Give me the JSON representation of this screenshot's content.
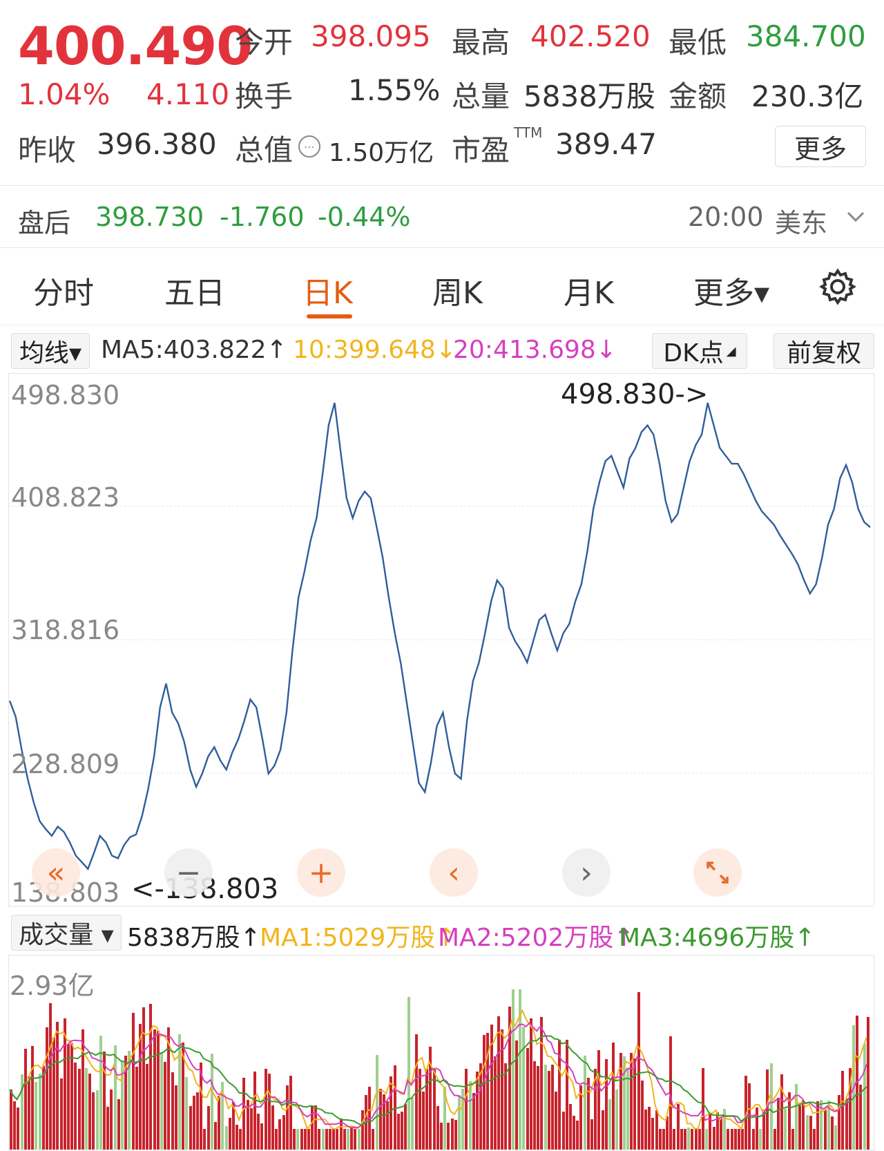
{
  "quote": {
    "price": "400.490",
    "change_pct": "1.04%",
    "change": "4.110",
    "prev_close_label": "昨收",
    "prev_close": "396.380",
    "open_label": "今开",
    "open": "398.095",
    "high_label": "最高",
    "high": "402.520",
    "low_label": "最低",
    "low": "384.700",
    "turnover_label": "换手",
    "turnover": "1.55%",
    "volume_label": "总量",
    "volume": "5838万股",
    "amount_label": "金额",
    "amount": "230.3亿",
    "mktcap_label": "总值",
    "mktcap": "1.50万亿",
    "pe_label": "市盈",
    "pe_sup": "TTM",
    "pe": "389.47",
    "more_label": "更多"
  },
  "after_hours": {
    "label": "盘后",
    "price": "398.730",
    "change": "-1.760",
    "change_pct": "-0.44%",
    "time": "20:00",
    "tz": "美东"
  },
  "tabs": [
    {
      "label": "分时"
    },
    {
      "label": "五日"
    },
    {
      "label": "日K"
    },
    {
      "label": "周K"
    },
    {
      "label": "月K"
    },
    {
      "label": "更多▾"
    }
  ],
  "indicators": {
    "select_label": "均线▾",
    "ma5": "MA5:403.822↑",
    "ma10": "10:399.648↓",
    "ma20": "20:413.698↓",
    "dk_label": "DK点",
    "adjust_label": "前复权"
  },
  "price_axis": [
    "498.830",
    "408.823",
    "318.816",
    "228.809",
    "138.803"
  ],
  "annotations": {
    "max": "498.830->",
    "min": "<-138.803"
  },
  "volume_header": {
    "select_label": "成交量 ▾",
    "vol": "5838万股↑",
    "ma1": "MA1:5029万股↑",
    "ma2": "MA2:5202万股↑",
    "ma3": "MA3:4696万股↑"
  },
  "volume_axis": "2.93亿",
  "colors": {
    "up": "#e2333c",
    "down": "#2e9e3e",
    "accent": "#e65b12",
    "line": "#2f5d9a",
    "ma1": "#f2b41c",
    "ma2": "#d63fbf",
    "ma3": "#3a9a2e"
  },
  "chart_data": {
    "type": "line",
    "ylim": [
      138.803,
      498.83
    ],
    "max_label": "498.830",
    "min_label": "138.803",
    "y": [
      267,
      255,
      230,
      208,
      190,
      176,
      170,
      165,
      172,
      168,
      160,
      150,
      145,
      140,
      152,
      165,
      160,
      150,
      148,
      158,
      164,
      166,
      180,
      200,
      225,
      262,
      280,
      258,
      250,
      236,
      215,
      202,
      212,
      225,
      232,
      222,
      215,
      228,
      238,
      252,
      268,
      262,
      238,
      212,
      218,
      230,
      258,
      305,
      345,
      365,
      388,
      405,
      438,
      475,
      492,
      455,
      420,
      405,
      418,
      425,
      420,
      398,
      375,
      345,
      318,
      295,
      265,
      235,
      205,
      198,
      220,
      248,
      258,
      232,
      212,
      208,
      252,
      282,
      296,
      318,
      342,
      358,
      352,
      322,
      312,
      305,
      296,
      312,
      328,
      332,
      318,
      305,
      318,
      325,
      342,
      355,
      380,
      412,
      432,
      448,
      452,
      440,
      428,
      450,
      458,
      470,
      475,
      468,
      446,
      418,
      402,
      408,
      428,
      448,
      460,
      468,
      492,
      475,
      458,
      452,
      446,
      446,
      438,
      428,
      418,
      410,
      405,
      400,
      392,
      385,
      378,
      370,
      358,
      348,
      355,
      375,
      400,
      412,
      435,
      445,
      432,
      412,
      402,
      398
    ]
  }
}
